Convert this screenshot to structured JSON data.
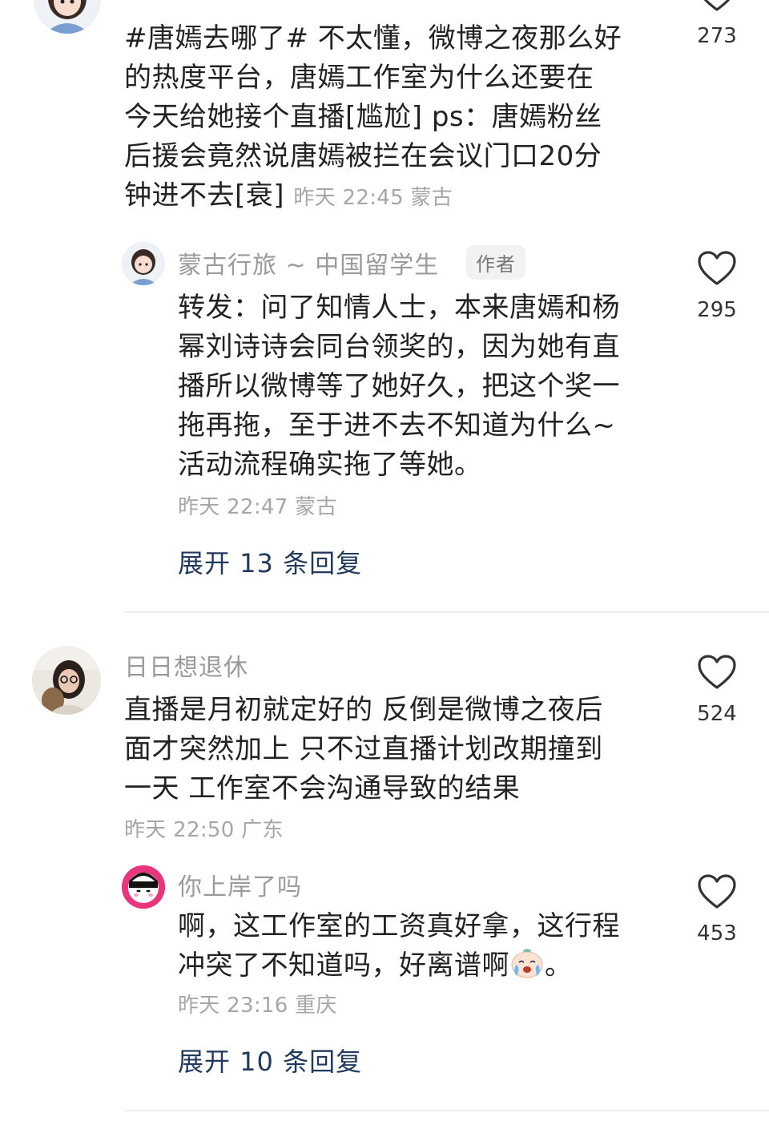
{
  "comments": [
    {
      "text_lines": [
        "#唐嫣去哪了# 不太懂，微博之夜那么好",
        "的热度平台，唐嫣工作室为什么还要在",
        "今天给她接个直播[尴尬]  ps：唐嫣粉丝",
        "后援会竟然说唐嫣被拦在会议门口20分",
        "钟进不去[衰]"
      ],
      "meta": "昨天 22:45 蒙古",
      "likes": "273",
      "reply": {
        "username": "蒙古行旅 ~ 中国留学生",
        "badge": "作者",
        "text_lines": [
          "转发：问了知情人士，本来唐嫣和杨",
          "幂刘诗诗会同台领奖的，因为她有直",
          "播所以微博等了她好久，把这个奖一",
          "拖再拖，至于进不去不知道为什么~",
          "活动流程确实拖了等她。"
        ],
        "meta": "昨天 22:47 蒙古",
        "likes": "295"
      },
      "expand_label": "展开 13 条回复"
    },
    {
      "username": "日日想退休",
      "text_lines": [
        "直播是月初就定好的 反倒是微博之夜后",
        "面才突然加上 只不过直播计划改期撞到",
        "一天 工作室不会沟通导致的结果"
      ],
      "meta": "昨天 22:50 广东",
      "likes": "524",
      "reply": {
        "username": "你上岸了吗",
        "text_lines": [
          "啊，这工作室的工资真好拿，这行程",
          "冲突了不知道吗，好离谱啊"
        ],
        "text_tail": "。",
        "inline_emoji": "crying-emoji",
        "meta": "昨天 23:16 重庆",
        "likes": "453"
      },
      "expand_label": "展开 10 条回复"
    }
  ],
  "icons": {
    "like": "heart-outline-icon"
  },
  "colors": {
    "link": "#1f3a5c",
    "meta": "#a6a6a6",
    "divider": "#eeeeee"
  }
}
